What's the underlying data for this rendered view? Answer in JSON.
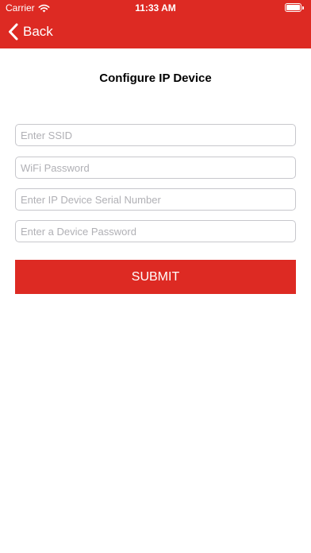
{
  "status_bar": {
    "carrier": "Carrier",
    "time": "11:33 AM",
    "icons": [
      "wifi-icon",
      "battery-icon"
    ]
  },
  "nav": {
    "back_label": "Back",
    "back_icon": "chevron-left-icon"
  },
  "page": {
    "title": "Configure IP Device"
  },
  "form": {
    "fields": [
      {
        "placeholder": "Enter SSID",
        "value": ""
      },
      {
        "placeholder": "WiFi Password",
        "value": ""
      },
      {
        "placeholder": "Enter IP Device Serial Number",
        "value": ""
      },
      {
        "placeholder": "Enter a Device Password",
        "value": ""
      }
    ],
    "submit_label": "SUBMIT"
  },
  "colors": {
    "brand_red": "#dd2a23",
    "background": "#ffffff",
    "field_border": "#c7c7cc",
    "placeholder": "#b0b0b5"
  }
}
